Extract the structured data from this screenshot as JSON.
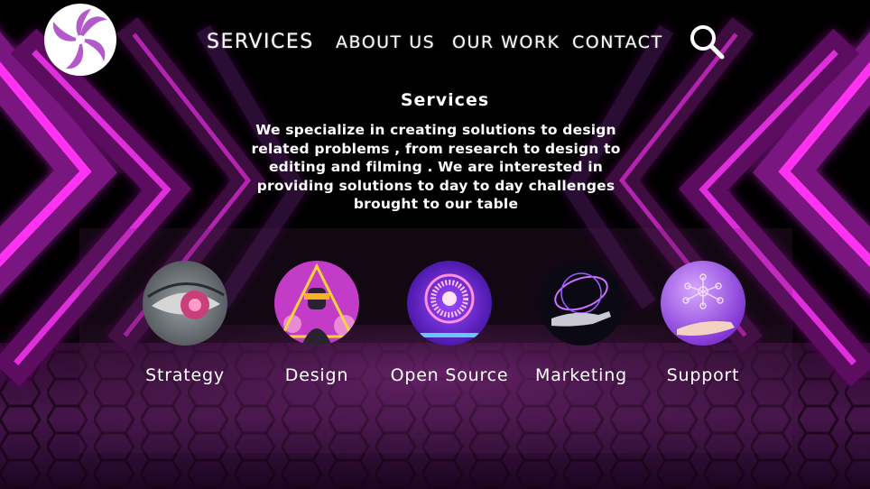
{
  "brand": {
    "logo_icon": "spiral-logo-icon",
    "accent": "#b25ac9"
  },
  "nav": {
    "items": [
      {
        "label": "SERVICES"
      },
      {
        "label": "ABOUT US"
      },
      {
        "label": "OUR WORK"
      },
      {
        "label": "CONTACT"
      }
    ],
    "search_icon": "search-icon"
  },
  "intro": {
    "title": "Services",
    "description": "We specialize in creating solutions to design related problems , from research to design to editing and filming . We are interested in providing solutions to day to day challenges brought to our table"
  },
  "services": [
    {
      "label": "Strategy",
      "icon": "eye-image"
    },
    {
      "label": "Design",
      "icon": "design-figure-image"
    },
    {
      "label": "Open Source",
      "icon": "glowing-disc-image"
    },
    {
      "label": "Marketing",
      "icon": "hand-orbit-image"
    },
    {
      "label": "Support",
      "icon": "hand-network-image"
    }
  ],
  "colors": {
    "neon_pink": "#ff3ff0",
    "neon_core": "#ffd8ff",
    "background": "#000000"
  }
}
